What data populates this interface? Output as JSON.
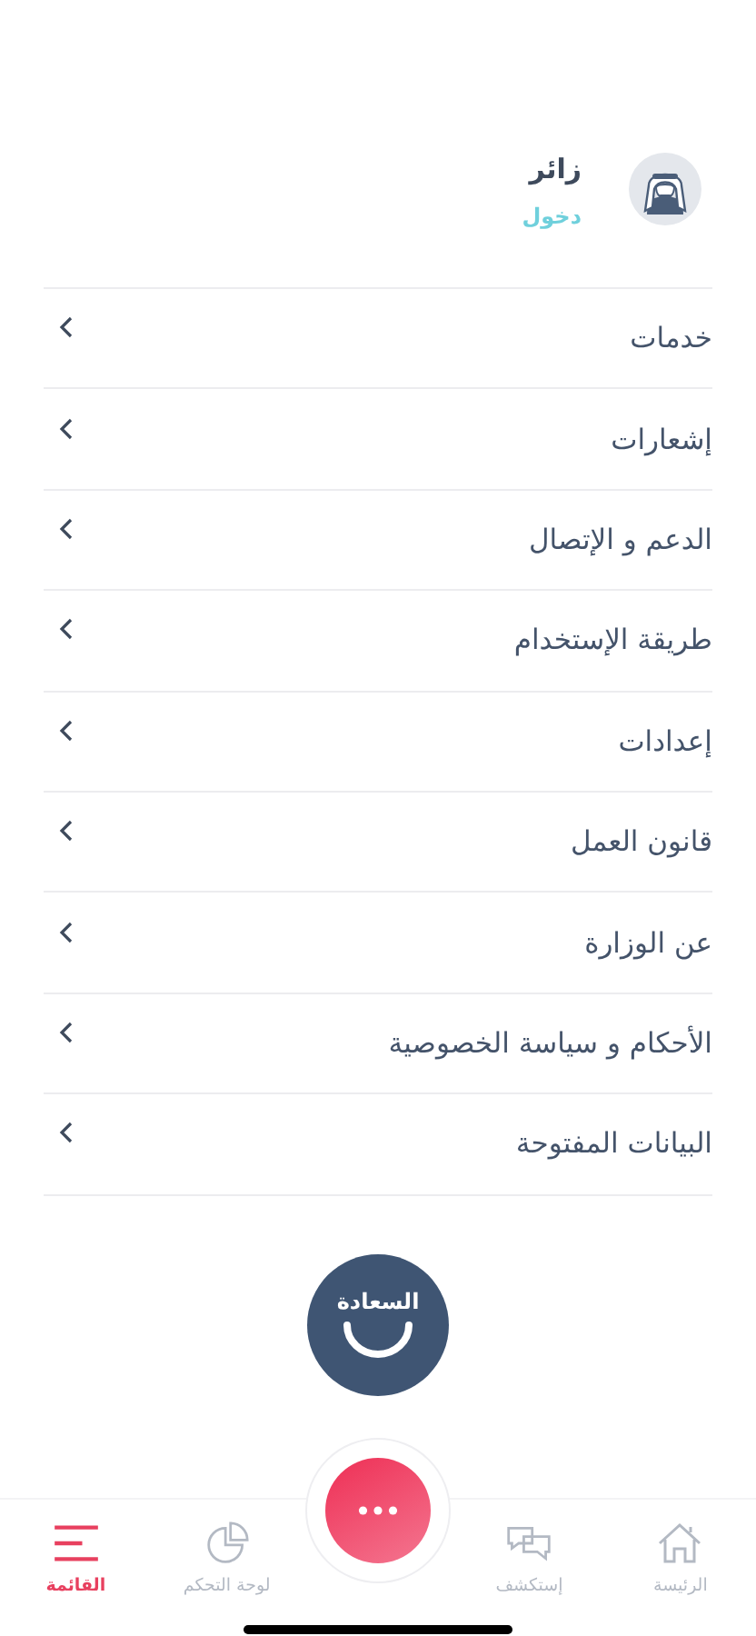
{
  "profile": {
    "name": "زائر",
    "login_link": "دخول"
  },
  "menu_items": [
    {
      "label": "خدمات"
    },
    {
      "label": "إشعارات"
    },
    {
      "label": "الدعم و الإتصال"
    },
    {
      "label": "طريقة الإستخدام"
    },
    {
      "label": "إعدادات"
    },
    {
      "label": "قانون العمل"
    },
    {
      "label": "عن الوزارة"
    },
    {
      "label": "الأحكام و سياسة الخصوصية"
    },
    {
      "label": "البيانات المفتوحة"
    }
  ],
  "happiness_button": {
    "label": "السعادة"
  },
  "tab_bar": [
    {
      "label": "الرئيسة",
      "kind": "home",
      "selected": false
    },
    {
      "label": "إستكشف",
      "kind": "explore",
      "selected": false
    },
    {
      "kind": "more"
    },
    {
      "label": "لوحة التحكم",
      "kind": "dashboard",
      "selected": false
    },
    {
      "label": "القائمة",
      "kind": "menu",
      "selected": true
    }
  ]
}
